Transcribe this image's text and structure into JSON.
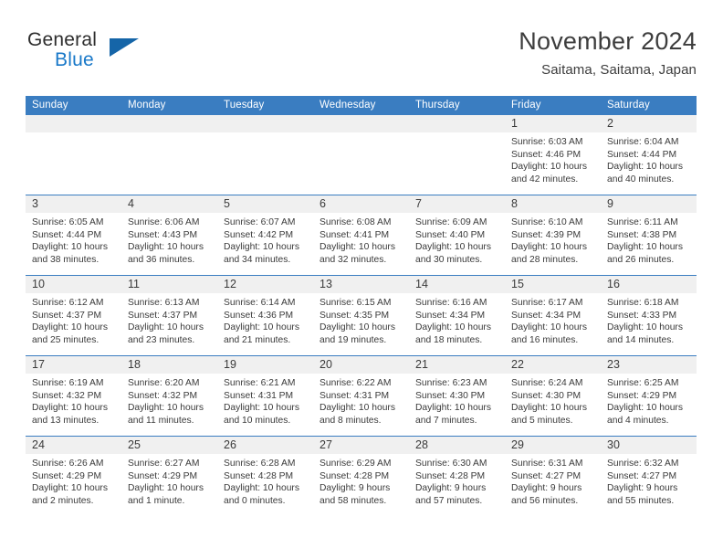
{
  "logo": {
    "word_top": "General",
    "word_bottom": "Blue",
    "triangle_color": "#1565a8",
    "blue_color": "#1878c8"
  },
  "header": {
    "title": "November 2024",
    "subtitle": "Saitama, Saitama, Japan"
  },
  "theme": {
    "header_blue": "#3a7dc1",
    "day_band_gray": "#f0f0f0",
    "text_color": "#3a3a3a"
  },
  "weekdays": [
    "Sunday",
    "Monday",
    "Tuesday",
    "Wednesday",
    "Thursday",
    "Friday",
    "Saturday"
  ],
  "weeks": [
    [
      {
        "day": "",
        "empty": true
      },
      {
        "day": "",
        "empty": true
      },
      {
        "day": "",
        "empty": true
      },
      {
        "day": "",
        "empty": true
      },
      {
        "day": "",
        "empty": true
      },
      {
        "day": "1",
        "sunrise": "Sunrise: 6:03 AM",
        "sunset": "Sunset: 4:46 PM",
        "daylight": "Daylight: 10 hours and 42 minutes."
      },
      {
        "day": "2",
        "sunrise": "Sunrise: 6:04 AM",
        "sunset": "Sunset: 4:44 PM",
        "daylight": "Daylight: 10 hours and 40 minutes."
      }
    ],
    [
      {
        "day": "3",
        "sunrise": "Sunrise: 6:05 AM",
        "sunset": "Sunset: 4:44 PM",
        "daylight": "Daylight: 10 hours and 38 minutes."
      },
      {
        "day": "4",
        "sunrise": "Sunrise: 6:06 AM",
        "sunset": "Sunset: 4:43 PM",
        "daylight": "Daylight: 10 hours and 36 minutes."
      },
      {
        "day": "5",
        "sunrise": "Sunrise: 6:07 AM",
        "sunset": "Sunset: 4:42 PM",
        "daylight": "Daylight: 10 hours and 34 minutes."
      },
      {
        "day": "6",
        "sunrise": "Sunrise: 6:08 AM",
        "sunset": "Sunset: 4:41 PM",
        "daylight": "Daylight: 10 hours and 32 minutes."
      },
      {
        "day": "7",
        "sunrise": "Sunrise: 6:09 AM",
        "sunset": "Sunset: 4:40 PM",
        "daylight": "Daylight: 10 hours and 30 minutes."
      },
      {
        "day": "8",
        "sunrise": "Sunrise: 6:10 AM",
        "sunset": "Sunset: 4:39 PM",
        "daylight": "Daylight: 10 hours and 28 minutes."
      },
      {
        "day": "9",
        "sunrise": "Sunrise: 6:11 AM",
        "sunset": "Sunset: 4:38 PM",
        "daylight": "Daylight: 10 hours and 26 minutes."
      }
    ],
    [
      {
        "day": "10",
        "sunrise": "Sunrise: 6:12 AM",
        "sunset": "Sunset: 4:37 PM",
        "daylight": "Daylight: 10 hours and 25 minutes."
      },
      {
        "day": "11",
        "sunrise": "Sunrise: 6:13 AM",
        "sunset": "Sunset: 4:37 PM",
        "daylight": "Daylight: 10 hours and 23 minutes."
      },
      {
        "day": "12",
        "sunrise": "Sunrise: 6:14 AM",
        "sunset": "Sunset: 4:36 PM",
        "daylight": "Daylight: 10 hours and 21 minutes."
      },
      {
        "day": "13",
        "sunrise": "Sunrise: 6:15 AM",
        "sunset": "Sunset: 4:35 PM",
        "daylight": "Daylight: 10 hours and 19 minutes."
      },
      {
        "day": "14",
        "sunrise": "Sunrise: 6:16 AM",
        "sunset": "Sunset: 4:34 PM",
        "daylight": "Daylight: 10 hours and 18 minutes."
      },
      {
        "day": "15",
        "sunrise": "Sunrise: 6:17 AM",
        "sunset": "Sunset: 4:34 PM",
        "daylight": "Daylight: 10 hours and 16 minutes."
      },
      {
        "day": "16",
        "sunrise": "Sunrise: 6:18 AM",
        "sunset": "Sunset: 4:33 PM",
        "daylight": "Daylight: 10 hours and 14 minutes."
      }
    ],
    [
      {
        "day": "17",
        "sunrise": "Sunrise: 6:19 AM",
        "sunset": "Sunset: 4:32 PM",
        "daylight": "Daylight: 10 hours and 13 minutes."
      },
      {
        "day": "18",
        "sunrise": "Sunrise: 6:20 AM",
        "sunset": "Sunset: 4:32 PM",
        "daylight": "Daylight: 10 hours and 11 minutes."
      },
      {
        "day": "19",
        "sunrise": "Sunrise: 6:21 AM",
        "sunset": "Sunset: 4:31 PM",
        "daylight": "Daylight: 10 hours and 10 minutes."
      },
      {
        "day": "20",
        "sunrise": "Sunrise: 6:22 AM",
        "sunset": "Sunset: 4:31 PM",
        "daylight": "Daylight: 10 hours and 8 minutes."
      },
      {
        "day": "21",
        "sunrise": "Sunrise: 6:23 AM",
        "sunset": "Sunset: 4:30 PM",
        "daylight": "Daylight: 10 hours and 7 minutes."
      },
      {
        "day": "22",
        "sunrise": "Sunrise: 6:24 AM",
        "sunset": "Sunset: 4:30 PM",
        "daylight": "Daylight: 10 hours and 5 minutes."
      },
      {
        "day": "23",
        "sunrise": "Sunrise: 6:25 AM",
        "sunset": "Sunset: 4:29 PM",
        "daylight": "Daylight: 10 hours and 4 minutes."
      }
    ],
    [
      {
        "day": "24",
        "sunrise": "Sunrise: 6:26 AM",
        "sunset": "Sunset: 4:29 PM",
        "daylight": "Daylight: 10 hours and 2 minutes."
      },
      {
        "day": "25",
        "sunrise": "Sunrise: 6:27 AM",
        "sunset": "Sunset: 4:29 PM",
        "daylight": "Daylight: 10 hours and 1 minute."
      },
      {
        "day": "26",
        "sunrise": "Sunrise: 6:28 AM",
        "sunset": "Sunset: 4:28 PM",
        "daylight": "Daylight: 10 hours and 0 minutes."
      },
      {
        "day": "27",
        "sunrise": "Sunrise: 6:29 AM",
        "sunset": "Sunset: 4:28 PM",
        "daylight": "Daylight: 9 hours and 58 minutes."
      },
      {
        "day": "28",
        "sunrise": "Sunrise: 6:30 AM",
        "sunset": "Sunset: 4:28 PM",
        "daylight": "Daylight: 9 hours and 57 minutes."
      },
      {
        "day": "29",
        "sunrise": "Sunrise: 6:31 AM",
        "sunset": "Sunset: 4:27 PM",
        "daylight": "Daylight: 9 hours and 56 minutes."
      },
      {
        "day": "30",
        "sunrise": "Sunrise: 6:32 AM",
        "sunset": "Sunset: 4:27 PM",
        "daylight": "Daylight: 9 hours and 55 minutes."
      }
    ]
  ]
}
